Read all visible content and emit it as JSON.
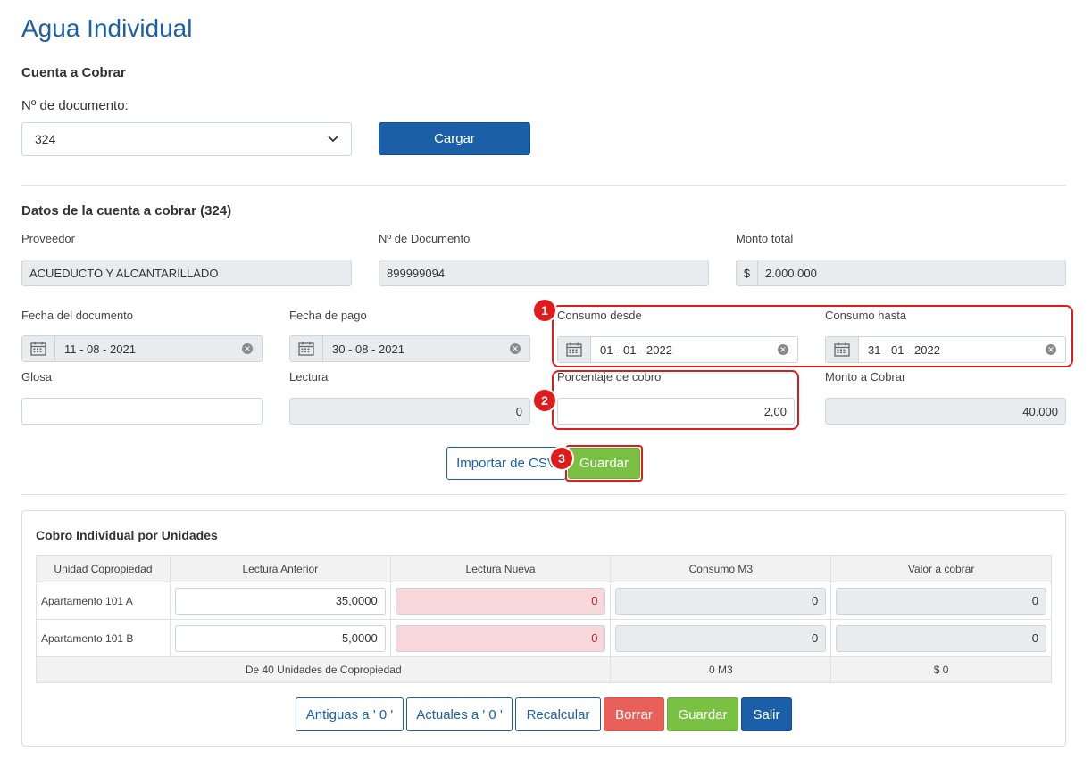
{
  "page": {
    "title": "Agua Individual"
  },
  "cuenta": {
    "section_title": "Cuenta a Cobrar",
    "doc_label": "Nº de documento:",
    "doc_selected": "324",
    "load_button": "Cargar"
  },
  "datos": {
    "section_title": "Datos de la cuenta a cobrar (324)",
    "proveedor": {
      "label": "Proveedor",
      "value": "ACUEDUCTO Y ALCANTARILLADO"
    },
    "num_documento": {
      "label": "Nº de Documento",
      "value": "899999094"
    },
    "monto_total": {
      "label": "Monto total",
      "prefix": "$",
      "value": "2.000.000"
    },
    "fecha_documento": {
      "label": "Fecha del documento",
      "value": "11 - 08 - 2021"
    },
    "fecha_pago": {
      "label": "Fecha de pago",
      "value": "30 - 08 - 2021"
    },
    "consumo_desde": {
      "label": "Consumo desde",
      "value": "01 - 01 - 2022"
    },
    "consumo_hasta": {
      "label": "Consumo hasta",
      "value": "31 - 01 - 2022"
    },
    "glosa": {
      "label": "Glosa",
      "value": ""
    },
    "lectura": {
      "label": "Lectura",
      "value": "0"
    },
    "porcentaje": {
      "label": "Porcentaje de cobro",
      "value": "2,00"
    },
    "monto_cobrar": {
      "label": "Monto a Cobrar",
      "value": "40.000"
    },
    "import_button": "Importar de CSV",
    "save_button": "Guardar"
  },
  "badges": {
    "b1": "1",
    "b2": "2",
    "b3": "3"
  },
  "unidades": {
    "title": "Cobro Individual por Unidades",
    "headers": [
      "Unidad Copropiedad",
      "Lectura Anterior",
      "Lectura Nueva",
      "Consumo M3",
      "Valor a cobrar"
    ],
    "rows": [
      {
        "unidad": "Apartamento 101 A",
        "lectura_anterior": "35,0000",
        "lectura_nueva": "0",
        "consumo": "0",
        "valor": "0"
      },
      {
        "unidad": "Apartamento 101 B",
        "lectura_anterior": "5,0000",
        "lectura_nueva": "0",
        "consumo": "0",
        "valor": "0"
      }
    ],
    "footer": {
      "unidades": "De 40 Unidades de Copropiedad",
      "consumo": "0 M3",
      "valor": "$ 0"
    },
    "buttons": {
      "antiguas": "Antiguas a ' 0 '",
      "actuales": "Actuales a ' 0 '",
      "recalcular": "Recalcular",
      "borrar": "Borrar",
      "guardar": "Guardar",
      "salir": "Salir"
    }
  },
  "colors": {
    "primary": "#1b5fa8",
    "success": "#7ac143",
    "danger": "#e8605a",
    "highlight": "#e01b1b",
    "invalid": "#f8d7da"
  }
}
